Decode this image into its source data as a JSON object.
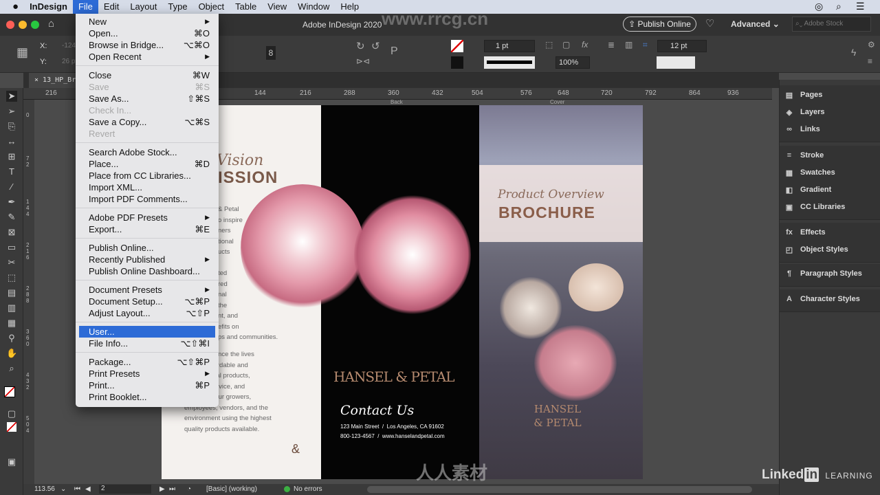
{
  "menubar": {
    "apple": "",
    "app": "InDesign",
    "items": [
      "File",
      "Edit",
      "Layout",
      "Type",
      "Object",
      "Table",
      "View",
      "Window",
      "Help"
    ],
    "active": "File"
  },
  "titlebar": {
    "title": "Adobe InDesign 2020",
    "publish_online": "Publish Online",
    "workspace": "Advanced",
    "stock_placeholder": "Adobe Stock"
  },
  "control": {
    "x_label": "X:",
    "y_label": "Y:",
    "x_value": "-124",
    "y_value": "26 pt",
    "stroke_weight": "1 pt",
    "opacity": "100%",
    "spacing": "12 pt"
  },
  "document": {
    "tab": "13_HP_Bro",
    "page_labels": [
      "Back",
      "Cover"
    ],
    "left_page": {
      "heading_script": "Vision",
      "heading": "ISSION",
      "para1": [
        "& Petal",
        "o inspire",
        "ners",
        "tional",
        "ucts",
        "",
        "ted",
        "red",
        "nal",
        "the",
        "nt, and",
        "efits on",
        "ps and communities."
      ],
      "para2": [
        "n is to enhance the lives",
        "hrough affordable and",
        "eautiful floral products,",
        "ustomer service, and",
        "espect for our growers,",
        "employees, vendors, and the",
        "environment using the highest",
        "quality products available."
      ]
    },
    "middle_page": {
      "logo": "HANSEL & PETAL",
      "contact_title": "Contact Us",
      "address": "123 Main Street  /  Los Angeles, CA 91602",
      "phone_web": "800-123-4567  /  www.hanselandpetal.com"
    },
    "cover": {
      "script": "Product Overview",
      "title": "BROCHURE",
      "logo": "HANSEL & PETAL"
    }
  },
  "ruler": {
    "h": [
      "216",
      "144",
      "216",
      "288",
      "360",
      "432",
      "504",
      "576",
      "648",
      "720",
      "792",
      "864",
      "936"
    ],
    "v": [
      "0",
      "7 2",
      "1 4 4",
      "2 1 6",
      "2 8 8",
      "3 6 0",
      "4 3 2",
      "5 0 4"
    ]
  },
  "file_menu": [
    {
      "label": "New",
      "sub": true
    },
    {
      "label": "Open...",
      "sc": "⌘O"
    },
    {
      "label": "Browse in Bridge...",
      "sc": "⌥⌘O"
    },
    {
      "label": "Open Recent",
      "sub": true
    },
    {
      "sep": true
    },
    {
      "label": "Close",
      "sc": "⌘W"
    },
    {
      "label": "Save",
      "sc": "⌘S",
      "dis": true
    },
    {
      "label": "Save As...",
      "sc": "⇧⌘S"
    },
    {
      "label": "Check In...",
      "dis": true
    },
    {
      "label": "Save a Copy...",
      "sc": "⌥⌘S"
    },
    {
      "label": "Revert",
      "dis": true
    },
    {
      "sep": true
    },
    {
      "label": "Search Adobe Stock..."
    },
    {
      "label": "Place...",
      "sc": "⌘D"
    },
    {
      "label": "Place from CC Libraries..."
    },
    {
      "label": "Import XML..."
    },
    {
      "label": "Import PDF Comments..."
    },
    {
      "sep": true
    },
    {
      "label": "Adobe PDF Presets",
      "sub": true
    },
    {
      "label": "Export...",
      "sc": "⌘E"
    },
    {
      "sep": true
    },
    {
      "label": "Publish Online..."
    },
    {
      "label": "Recently Published",
      "sub": true
    },
    {
      "label": "Publish Online Dashboard..."
    },
    {
      "sep": true
    },
    {
      "label": "Document Presets",
      "sub": true
    },
    {
      "label": "Document Setup...",
      "sc": "⌥⌘P"
    },
    {
      "label": "Adjust Layout...",
      "sc": "⌥⇧P"
    },
    {
      "sep": true
    },
    {
      "label": "User...",
      "hl": true
    },
    {
      "label": "File Info...",
      "sc": "⌥⇧⌘I"
    },
    {
      "sep": true
    },
    {
      "label": "Package...",
      "sc": "⌥⇧⌘P"
    },
    {
      "label": "Print Presets",
      "sub": true
    },
    {
      "label": "Print...",
      "sc": "⌘P"
    },
    {
      "label": "Print Booklet..."
    }
  ],
  "panels": [
    {
      "label": "Pages",
      "icon": "pages-icon",
      "glyph": "▤"
    },
    {
      "label": "Layers",
      "icon": "layers-icon",
      "glyph": "◈"
    },
    {
      "label": "Links",
      "icon": "links-icon",
      "glyph": "∞"
    },
    {
      "label": "Stroke",
      "icon": "stroke-icon",
      "glyph": "≡"
    },
    {
      "label": "Swatches",
      "icon": "swatches-icon",
      "glyph": "▦"
    },
    {
      "label": "Gradient",
      "icon": "gradient-icon",
      "glyph": "◧"
    },
    {
      "label": "CC Libraries",
      "icon": "cc-libraries-icon",
      "glyph": "▣"
    },
    {
      "label": "Effects",
      "icon": "effects-icon",
      "glyph": "fx"
    },
    {
      "label": "Object Styles",
      "icon": "object-styles-icon",
      "glyph": "◰"
    },
    {
      "label": "Paragraph Styles",
      "icon": "paragraph-styles-icon",
      "glyph": "¶"
    },
    {
      "label": "Character Styles",
      "icon": "character-styles-icon",
      "glyph": "A"
    }
  ],
  "status": {
    "zoom": "113.56",
    "page": "2",
    "preflight_profile": "[Basic] (working)",
    "errors": "No errors",
    "error_color": "#3cb043"
  },
  "watermark": {
    "url": "www.rrcg.cn",
    "brand": "人人素材",
    "linkedin": "Linked",
    "linkedin_in": "in",
    "learning": "LEARNING"
  }
}
